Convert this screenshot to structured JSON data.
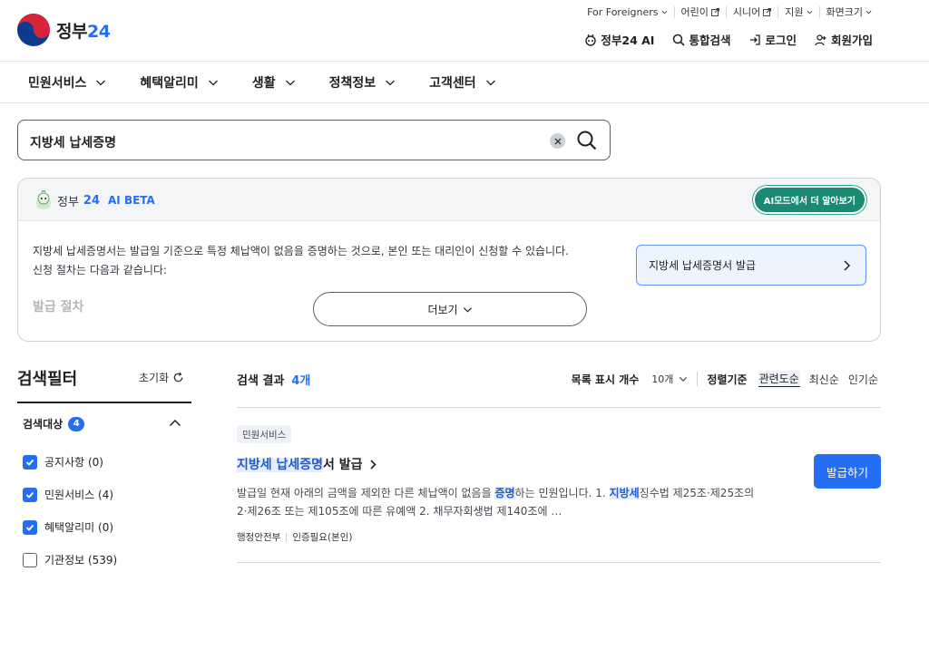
{
  "header": {
    "logo_text": "정부",
    "logo_num": "24",
    "util": [
      "For Foreigners",
      "어린이",
      "시니어",
      "지원",
      "화면크기"
    ],
    "links": {
      "ai": "정부24 AI",
      "search": "통합검색",
      "login": "로그인",
      "signup": "회원가입"
    }
  },
  "nav": [
    "민원서비스",
    "혜택알리미",
    "생활",
    "정책정보",
    "고객센터"
  ],
  "search": {
    "query": "지방세 납세증명"
  },
  "ai": {
    "brand": "정부",
    "brand_num": "24",
    "beta": "AI BETA",
    "mode_button": "AI모드에서 더 알아보기",
    "answer_line1": "지방세 납세증명서는 발급일 기준으로 특정 체납액이 없음을 증명하는 것으로, 본인 또는 대리인이 신청할 수 있습니다.",
    "answer_line2": "신청 절차는 다음과 같습니다:",
    "procedure": "발급 절차",
    "more": "더보기",
    "cta": "지방세 납세증명서 발급"
  },
  "filter": {
    "title": "검색필터",
    "reset": "초기화",
    "group": "검색대상",
    "group_count": "4",
    "items": [
      {
        "label": "공지사항 (0)",
        "checked": true
      },
      {
        "label": "민원서비스 (4)",
        "checked": true
      },
      {
        "label": "혜택알리미 (0)",
        "checked": true
      },
      {
        "label": "기관정보 (539)",
        "checked": false
      }
    ]
  },
  "results": {
    "title": "검색 결과",
    "count": "4개",
    "page_size_label": "목록 표시 개수",
    "page_size": "10개",
    "sort_label": "정렬기준",
    "sort_options": [
      "관련도순",
      "최신순",
      "인기순"
    ],
    "active_sort": "관련도순",
    "item": {
      "category": "민원서비스",
      "title_hl": "지방세 납세증명",
      "title_rest": "서 발급",
      "desc_a": "발급일 현재 아래의 금액을 제외한 다른 체납액이 없음을 ",
      "desc_hl1": "증명",
      "desc_b": "하는 민원입니다. 1. ",
      "desc_hl2": "지방세",
      "desc_c": "징수법 제25조·제25조의",
      "desc_line2": "2·제26조 또는 제105조에 따른 유예액 2. 채무자회생법 제140조에 …",
      "agency": "행정안전부",
      "auth": "인증필요(본인)",
      "button": "발급하기"
    }
  }
}
